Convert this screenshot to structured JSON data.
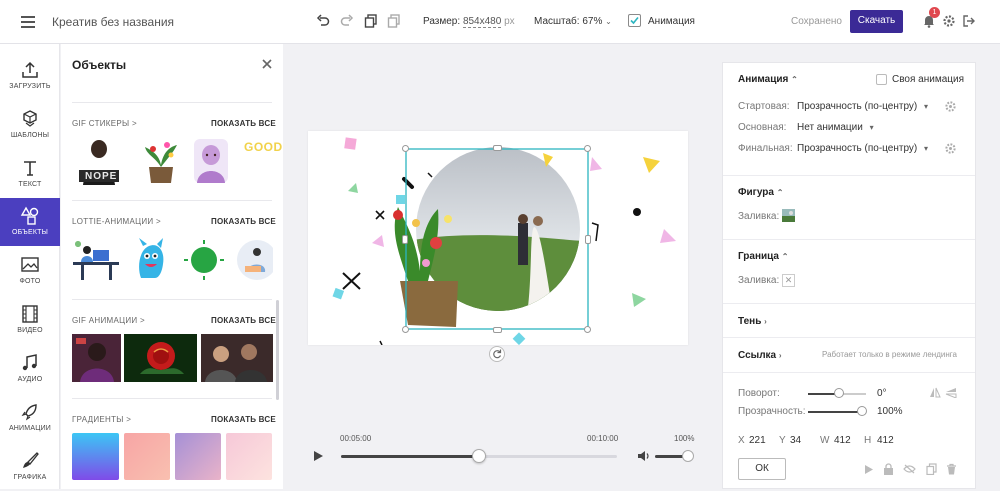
{
  "header": {
    "title": "Креатив без названия",
    "size_label": "Размер:",
    "size_value": "854x480",
    "size_unit": "px",
    "zoom_label": "Масштаб: 67%",
    "animation_label": "Анимация",
    "saved_status": "Сохранено",
    "download_label": "Скачать",
    "notification_count": "1"
  },
  "rail": {
    "items": [
      {
        "label": "ЗАГРУЗИТЬ",
        "icon": "upload-icon"
      },
      {
        "label": "ШАБЛОНЫ",
        "icon": "templates-icon"
      },
      {
        "label": "ТЕКСТ",
        "icon": "text-icon"
      },
      {
        "label": "ОБЪЕКТЫ",
        "icon": "objects-icon"
      },
      {
        "label": "ФОТО",
        "icon": "photo-icon"
      },
      {
        "label": "ВИДЕО",
        "icon": "video-icon"
      },
      {
        "label": "АУДИО",
        "icon": "audio-icon"
      },
      {
        "label": "АНИМАЦИИ",
        "icon": "rocket-icon"
      },
      {
        "label": "ГРАФИКА",
        "icon": "brush-icon"
      }
    ]
  },
  "objects_panel": {
    "title": "Объекты",
    "show_all": "ПОКАЗАТЬ ВСЕ",
    "sections": [
      {
        "title": "GIF СТИКЕРЫ >"
      },
      {
        "title": "LOTTIE-АНИМАЦИИ >"
      },
      {
        "title": "GIF АНИМАЦИИ >"
      },
      {
        "title": "ГРАДИЕНТЫ >"
      }
    ],
    "sticker_text": "NOPE",
    "sticker_text2": "GOOD"
  },
  "timeline": {
    "time_current": "00:05:00",
    "time_end": "00:10:00",
    "volume": "100%",
    "progress": 0.5,
    "volume_level": 1.0
  },
  "right_panel": {
    "animation_head": "Анимация",
    "own_animation": "Своя анимация",
    "start_label": "Стартовая:",
    "start_value": "Прозрачность (по-центру)",
    "main_label": "Основная:",
    "main_value": "Нет анимации",
    "final_label": "Финальная:",
    "final_value": "Прозрачность (по-центру)",
    "shape_head": "Фигура",
    "fill_label": "Заливка:",
    "border_head": "Граница",
    "border_fill_label": "Заливка:",
    "shadow_head": "Тень",
    "link_head": "Ссылка",
    "link_note": "Работает только в режиме лендинга",
    "rotate_label": "Поворот:",
    "rotate_value": "0°",
    "opacity_label": "Прозрачность:",
    "opacity_value": "100%",
    "x_label": "X",
    "x_value": "221",
    "y_label": "Y",
    "y_value": "34",
    "w_label": "W",
    "w_value": "412",
    "h_label": "H",
    "h_value": "412",
    "ok_label": "ОК"
  },
  "colors": {
    "accent": "#4b3fbf",
    "download": "#3b2a96",
    "selection": "#2cb5c0"
  }
}
